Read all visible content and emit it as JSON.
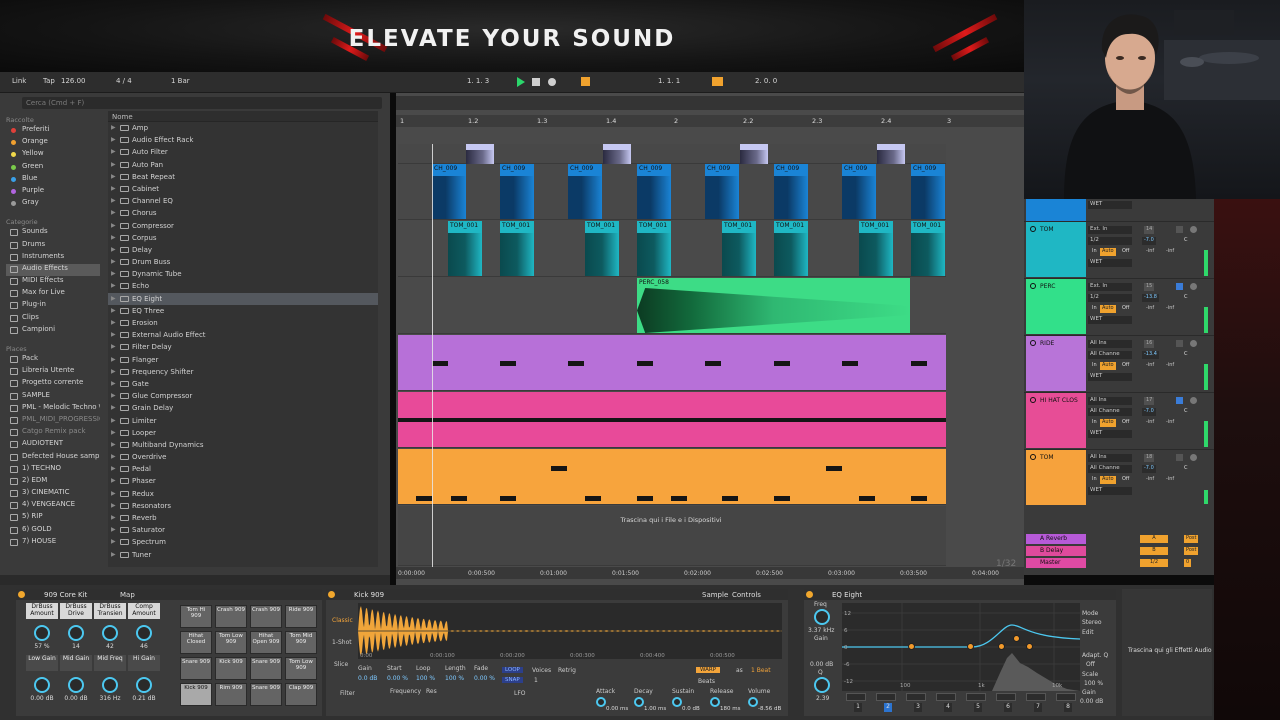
{
  "banner": {
    "title": "ELEVATE YOUR SOUND"
  },
  "transport": {
    "link": "Link",
    "tap": "Tap",
    "tempo": "126.00",
    "meter": "4 / 4",
    "quantize": "1 Bar",
    "position": "1. 1. 3",
    "loop_start": "1. 1. 1",
    "loop_length": "2. 0. 0"
  },
  "browser": {
    "search_placeholder": "Cerca (Cmd + F)",
    "collections_header": "Raccolte",
    "collections": [
      {
        "label": "Preferiti",
        "color": "#e0403a"
      },
      {
        "label": "Orange",
        "color": "#f0a030"
      },
      {
        "label": "Yellow",
        "color": "#f0d84a"
      },
      {
        "label": "Green",
        "color": "#7acb4a"
      },
      {
        "label": "Blue",
        "color": "#3aa0e8"
      },
      {
        "label": "Purple",
        "color": "#b265e0"
      },
      {
        "label": "Gray",
        "color": "#9a9a9a"
      }
    ],
    "categories_header": "Categorie",
    "categories": [
      "Sounds",
      "Drums",
      "Instruments",
      "Audio Effects",
      "MIDI Effects",
      "Max for Live",
      "Plug-in",
      "Clips",
      "Campioni"
    ],
    "selected_category": "Audio Effects",
    "places_header": "Places",
    "places": [
      "Pack",
      "Libreria Utente",
      "Progetto corrente",
      "SAMPLE",
      "PML - Melodic Techno \\",
      "PML_MIDI_PROGRESSIO",
      "Catgo Remix pack",
      "AUDIOTENT",
      "Defected House sample",
      "1) TECHNO",
      "2) EDM",
      "3) CINEMATIC",
      "4) VENGEANCE",
      "5) RIP",
      "6) GOLD",
      "7) HOUSE"
    ],
    "files_header": "Nome",
    "files": [
      "Amp",
      "Audio Effect Rack",
      "Auto Filter",
      "Auto Pan",
      "Beat Repeat",
      "Cabinet",
      "Channel EQ",
      "Chorus",
      "Compressor",
      "Corpus",
      "Delay",
      "Drum Buss",
      "Dynamic Tube",
      "Echo",
      "EQ Eight",
      "EQ Three",
      "Erosion",
      "External Audio Effect",
      "Filter Delay",
      "Flanger",
      "Frequency Shifter",
      "Gate",
      "Glue Compressor",
      "Grain Delay",
      "Limiter",
      "Looper",
      "Multiband Dynamics",
      "Overdrive",
      "Pedal",
      "Phaser",
      "Redux",
      "Resonators",
      "Reverb",
      "Saturator",
      "Spectrum",
      "Tuner"
    ],
    "selected_file": "EQ Eight"
  },
  "arrangement": {
    "ruler": [
      "1",
      "1.2",
      "1.3",
      "1.4",
      "2",
      "2.2",
      "2.3",
      "2.4",
      "3"
    ],
    "clips": {
      "ch": "CH_009",
      "tom": "TOM_001",
      "perc": "PERC_058"
    },
    "drop_hint": "Trascina qui i File e i Dispositivi",
    "timeline": [
      "0:00:000",
      "0:00:500",
      "0:01:000",
      "0:01:500",
      "0:02:000",
      "0:02:500",
      "0:03:000",
      "0:03:500",
      "0:04:000"
    ],
    "page_indicator": "1/32"
  },
  "mixer": {
    "tracks": [
      {
        "name": "TOM",
        "color": "#1fb7c4",
        "input": "Ext. In",
        "channel": "1/2",
        "vol": "-7.0",
        "num": "14"
      },
      {
        "name": "PERC",
        "color": "#32e08a",
        "input": "Ext. In",
        "channel": "1/2",
        "vol": "-13.8",
        "num": "15"
      },
      {
        "name": "RIDE",
        "color": "#b874d8",
        "input": "All Ins",
        "channel": "All Channe",
        "vol": "-13.4",
        "num": "16"
      },
      {
        "name": "HI HAT CLOS",
        "color": "#e74d96",
        "input": "All Ins",
        "channel": "All Channe",
        "vol": "-7.0",
        "num": "17"
      },
      {
        "name": "TOM",
        "color": "#f6a23c",
        "input": "All Ins",
        "channel": "All Channe",
        "vol": "-7.0",
        "num": "18"
      }
    ],
    "wet": "WET",
    "in": "In",
    "auto": "Auto",
    "off": "Off",
    "inf": "-inf",
    "c": "C",
    "returns": [
      {
        "name": "A Reverb",
        "color": "#b75ad8",
        "send": "A",
        "post": "Post"
      },
      {
        "name": "B Delay",
        "color": "#e04a9c",
        "send": "B",
        "post": "Post"
      },
      {
        "name": "Master",
        "color": "#e04aa4",
        "send": "1/2",
        "post": "0"
      }
    ]
  },
  "drum_rack": {
    "title": "909 Core Kit",
    "map": "Map",
    "macros": [
      {
        "label": "DrBuss Amount",
        "value": "57 %"
      },
      {
        "label": "DrBuss Drive",
        "value": "14"
      },
      {
        "label": "DrBuss Transien",
        "value": "42"
      },
      {
        "label": "Comp Amount",
        "value": "46"
      },
      {
        "label": "Low Gain",
        "value": "0.00 dB"
      },
      {
        "label": "Mid Gain",
        "value": "0.00 dB"
      },
      {
        "label": "Mid Freq",
        "value": "316 Hz"
      },
      {
        "label": "Hi Gain",
        "value": "0.21 dB"
      }
    ],
    "pads": [
      "Tom Hi 909",
      "Crash 909",
      "Crash 909",
      "Ride 909",
      "Hihat Closed",
      "Tom Low 909",
      "Hihat Open 909",
      "Tom Mid 909",
      "Snare 909",
      "Kick 909",
      "Snare 909",
      "Tom Low 909",
      "Kick 909",
      "Rim 909",
      "Snare 909",
      "Clap 909"
    ],
    "selected_pad": "Kick 909"
  },
  "simpler": {
    "title": "Kick 909",
    "tabs": [
      "Sample",
      "Controls"
    ],
    "mode": "Classic",
    "mode2": "1-Shot",
    "mode3": "Slice",
    "params": [
      {
        "label": "Gain",
        "value": "0.0 dB"
      },
      {
        "label": "Start",
        "value": "0.00 %"
      },
      {
        "label": "Loop",
        "value": "100 %"
      },
      {
        "label": "Length",
        "value": "100 %"
      },
      {
        "label": "Fade",
        "value": "0.00 %"
      }
    ],
    "loop": "LOOP",
    "snap": "SNAP",
    "voices": "Voices",
    "voices_val": "1",
    "retrig": "Retrig",
    "warp": "WARP",
    "as": "as",
    "beat": "1 Beat",
    "beats": "Beats",
    "ruler": [
      "0:00",
      "0:00:100",
      "0:00:200",
      "0:00:300",
      "0:00:400",
      "0:00:500"
    ],
    "filter": "Filter",
    "freq": "Frequency",
    "res": "Res",
    "lfo": "LFO",
    "env": [
      {
        "label": "Attack",
        "value": "0.00 ms"
      },
      {
        "label": "Decay",
        "value": "1.00 ms"
      },
      {
        "label": "Sustain",
        "value": "0.0 dB"
      },
      {
        "label": "Release",
        "value": "180 ms"
      },
      {
        "label": "Volume",
        "value": "-8.56 dB"
      }
    ]
  },
  "eq": {
    "title": "EQ Eight",
    "freq_label": "Freq",
    "freq": "3.37 kHz",
    "gain_label": "Gain",
    "gain": "0.00 dB",
    "q_label": "Q",
    "q": "2.39",
    "db_ticks": [
      "12",
      "6",
      "0",
      "-6",
      "-12"
    ],
    "bands": [
      "1",
      "2",
      "3",
      "4",
      "5",
      "6",
      "7",
      "8"
    ],
    "mode_label": "Mode",
    "mode": "Stereo",
    "edit": "Edit",
    "adapt": "Adapt. Q",
    "adapt_val": "Off",
    "scale_label": "Scale",
    "scale": "100 %",
    "gain_out_label": "Gain",
    "gain_out": "0.00 dB",
    "freq_marks": [
      "100",
      "1k",
      "10k"
    ],
    "drop_hint": "Trascina qui gli Effetti Audio"
  },
  "colors": {
    "blue": "#1a84d6",
    "teal": "#1fb7c4",
    "green": "#3ddc86",
    "purple": "#b770d8",
    "pink": "#e84a99",
    "orange": "#f7a43d"
  }
}
